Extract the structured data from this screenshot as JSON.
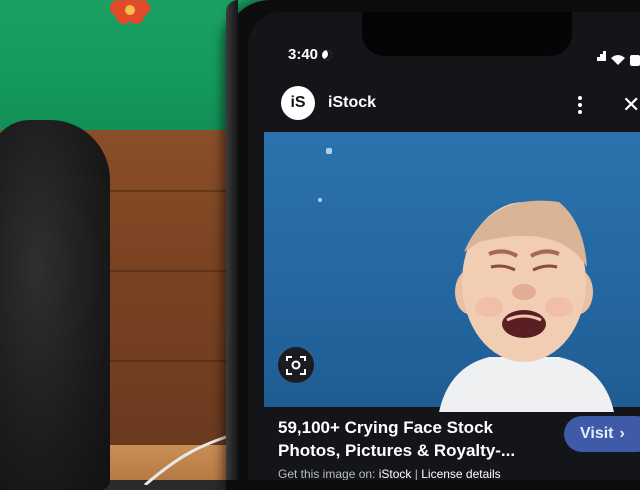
{
  "status_bar": {
    "time": "3:40"
  },
  "app_header": {
    "logo_text": "iS",
    "brand": "iStock"
  },
  "result": {
    "title": "59,100+ Crying Face Stock Photos, Pictures & Royalty-...",
    "source_prefix": "Get this image on:",
    "source_site": "iStock",
    "separator": "|",
    "license_link": "License details",
    "visit_label": "Visit",
    "visit_chevron": "›"
  },
  "icons": {
    "menu": "kebab-menu-icon",
    "close": "close-icon",
    "lens": "lens-search-icon",
    "wifi": "wifi-icon",
    "signal": "signal-icon",
    "battery": "battery-icon"
  },
  "colors": {
    "screen_bg": "#141518",
    "image_bg": "#2b73ad",
    "visit_button": "#3f5aa6",
    "wall_green": "#1aa062",
    "wood": "#7b4322"
  }
}
